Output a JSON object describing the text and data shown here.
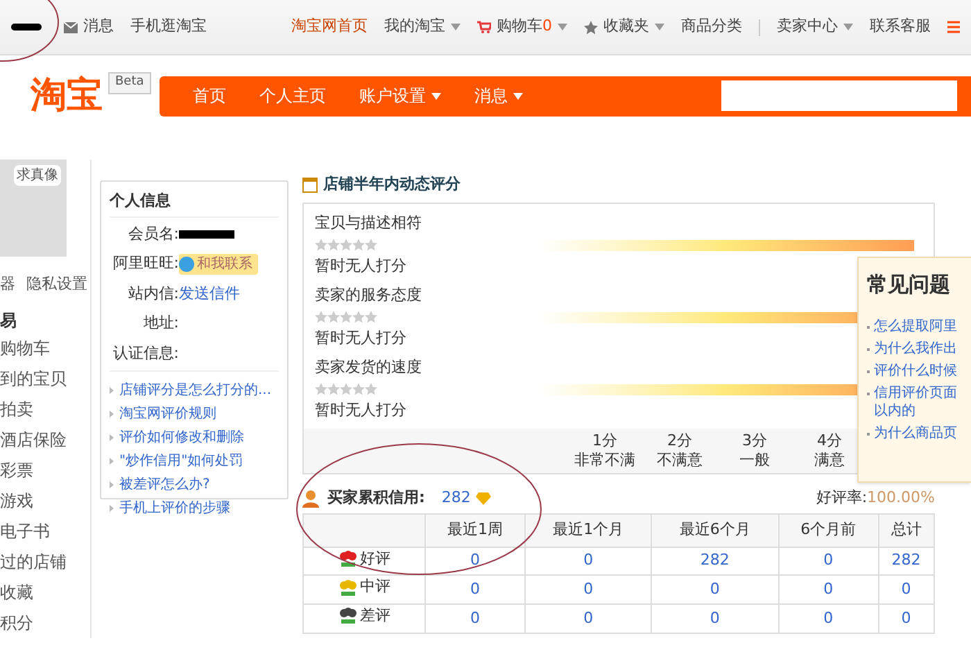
{
  "top_bar": {
    "left": [
      {
        "label": "消息",
        "kind": "mail"
      },
      {
        "label": "手机逛淘宝",
        "kind": "plain"
      }
    ],
    "right": [
      {
        "label": "淘宝网首页",
        "kind": "home"
      },
      {
        "label": "我的淘宝",
        "kind": "menu"
      },
      {
        "label": "购物车",
        "count": "0",
        "kind": "cart"
      },
      {
        "label": "收藏夹",
        "kind": "star"
      },
      {
        "label": "商品分类",
        "kind": "plain"
      },
      {
        "label": "卖家中心",
        "kind": "menu"
      },
      {
        "label": "联系客服",
        "kind": "plain"
      }
    ]
  },
  "logo": {
    "text": "淘宝",
    "badge": "Beta"
  },
  "nav": {
    "items": [
      {
        "label": "首页",
        "dropdown": false
      },
      {
        "label": "个人主页",
        "dropdown": false
      },
      {
        "label": "账户设置",
        "dropdown": true
      },
      {
        "label": "消息",
        "dropdown": true
      }
    ]
  },
  "sidebar": {
    "avatar_label": "求真像",
    "links": [
      "器",
      "隐私设置"
    ],
    "heading": "易",
    "items": [
      "购物车",
      "到的宝贝",
      "拍卖",
      "酒店保险",
      "彩票",
      "游戏",
      "电子书",
      "过的店铺",
      "收藏",
      "积分"
    ]
  },
  "personal_info": {
    "title": "个人信息",
    "fields": [
      {
        "label": "会员名:",
        "kind": "redacted"
      },
      {
        "label": "阿里旺旺:",
        "kind": "chat",
        "value": "和我联系"
      },
      {
        "label": "站内信:",
        "kind": "link",
        "value": "发送信件"
      },
      {
        "label": "地址:",
        "kind": "empty"
      },
      {
        "label": "认证信息:",
        "kind": "empty"
      }
    ],
    "links": [
      "店铺评分是怎么打分的...",
      "淘宝网评价规则",
      "评价如何修改和删除",
      "\"炒作信用\"如何处罚",
      "被差评怎么办?",
      "手机上评价的步骤"
    ]
  },
  "ratings": {
    "title": "店铺半年内动态评分",
    "items": [
      {
        "label": "宝贝与描述相符",
        "stars": 0,
        "status": "暂时无人打分"
      },
      {
        "label": "卖家的服务态度",
        "stars": 0,
        "status": "暂时无人打分"
      },
      {
        "label": "卖家发货的速度",
        "stars": 0,
        "status": "暂时无人打分"
      }
    ],
    "scale": [
      {
        "score": "1分",
        "meaning": "非常不满"
      },
      {
        "score": "2分",
        "meaning": "不满意"
      },
      {
        "score": "3分",
        "meaning": "一般"
      },
      {
        "score": "4分",
        "meaning": "满意"
      }
    ]
  },
  "faq": {
    "title": "常见问题",
    "items": [
      "怎么提取阿里",
      "为什么我作出",
      "评价什么时候",
      "信用评价页面以内的",
      "为什么商品页"
    ]
  },
  "credit": {
    "label": "买家累积信用:",
    "score": "282",
    "rate_label": "好评率:",
    "rate": "100.00%"
  },
  "table": {
    "columns": [
      "最近1周",
      "最近1个月",
      "最近6个月",
      "6个月前",
      "总计"
    ],
    "rows": [
      {
        "label": "好评",
        "kind": "good",
        "cells": [
          "0",
          "0",
          "282",
          "0",
          "282"
        ]
      },
      {
        "label": "中评",
        "kind": "neutral",
        "cells": [
          "0",
          "0",
          "0",
          "0",
          "0"
        ]
      },
      {
        "label": "差评",
        "kind": "bad",
        "cells": [
          "0",
          "0",
          "0",
          "0",
          "0"
        ]
      }
    ]
  }
}
